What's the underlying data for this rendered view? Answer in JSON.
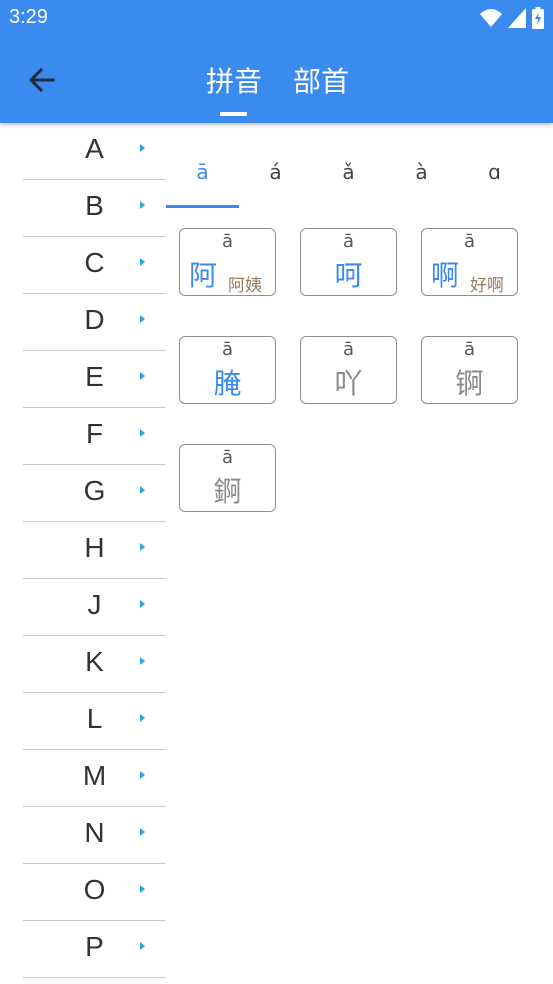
{
  "status": {
    "time": "3:29"
  },
  "header": {
    "tabs": [
      {
        "label": "拼音"
      },
      {
        "label": "部首"
      }
    ]
  },
  "sidebar": {
    "letters": [
      "A",
      "B",
      "C",
      "D",
      "E",
      "F",
      "G",
      "H",
      "J",
      "K",
      "L",
      "M",
      "N",
      "O",
      "P"
    ]
  },
  "tones": [
    "ā",
    "á",
    "ǎ",
    "à",
    "ɑ"
  ],
  "cards": [
    {
      "pinyin": "ā",
      "char": "阿",
      "word": "阿姨",
      "style": "blue"
    },
    {
      "pinyin": "ā",
      "char": "呵",
      "word": "",
      "style": "blue"
    },
    {
      "pinyin": "ā",
      "char": "啊",
      "word": "好啊",
      "style": "blue"
    },
    {
      "pinyin": "ā",
      "char": "腌",
      "word": "",
      "style": "blue"
    },
    {
      "pinyin": "ā",
      "char": "吖",
      "word": "",
      "style": "gray"
    },
    {
      "pinyin": "ā",
      "char": "锕",
      "word": "",
      "style": "gray"
    },
    {
      "pinyin": "ā",
      "char": "錒",
      "word": "",
      "style": "gray"
    }
  ],
  "colors": {
    "primary": "#3a8af0",
    "arrow": "#2aa3e8",
    "word": "#9a7a5c"
  }
}
